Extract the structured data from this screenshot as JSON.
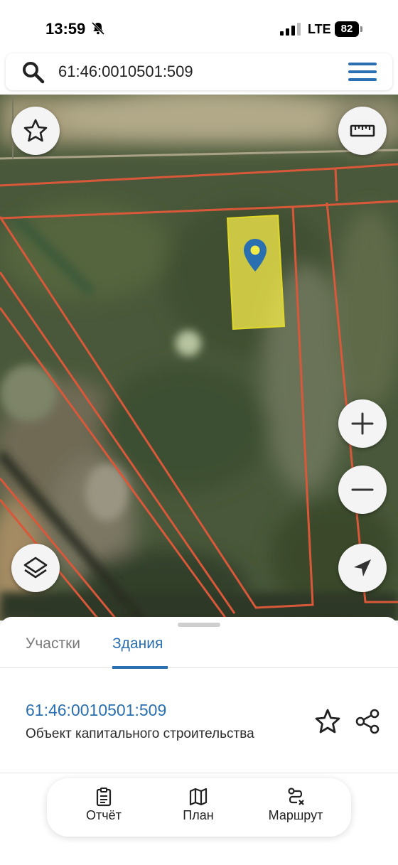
{
  "status_bar": {
    "time": "13:59",
    "network": "LTE",
    "battery": "82"
  },
  "search": {
    "value": "61:46:0010501:509"
  },
  "colors": {
    "accent": "#2a6fb0",
    "parcel_border": "#d9583a",
    "building_fill": "#f2e94a"
  },
  "map": {
    "buttons": {
      "favorite": "star-icon",
      "ruler": "ruler-icon",
      "zoom_in": "plus-icon",
      "zoom_out": "minus-icon",
      "layers": "layers-icon",
      "locate": "navigation-arrow-icon"
    }
  },
  "sheet": {
    "tabs": [
      {
        "label": "Участки",
        "active": false
      },
      {
        "label": "Здания",
        "active": true
      }
    ],
    "result": {
      "number": "61:46:0010501:509",
      "type": "Объект капитального строительства"
    },
    "actions": {
      "report": "Отчёт",
      "plan": "План",
      "route": "Маршрут"
    }
  }
}
